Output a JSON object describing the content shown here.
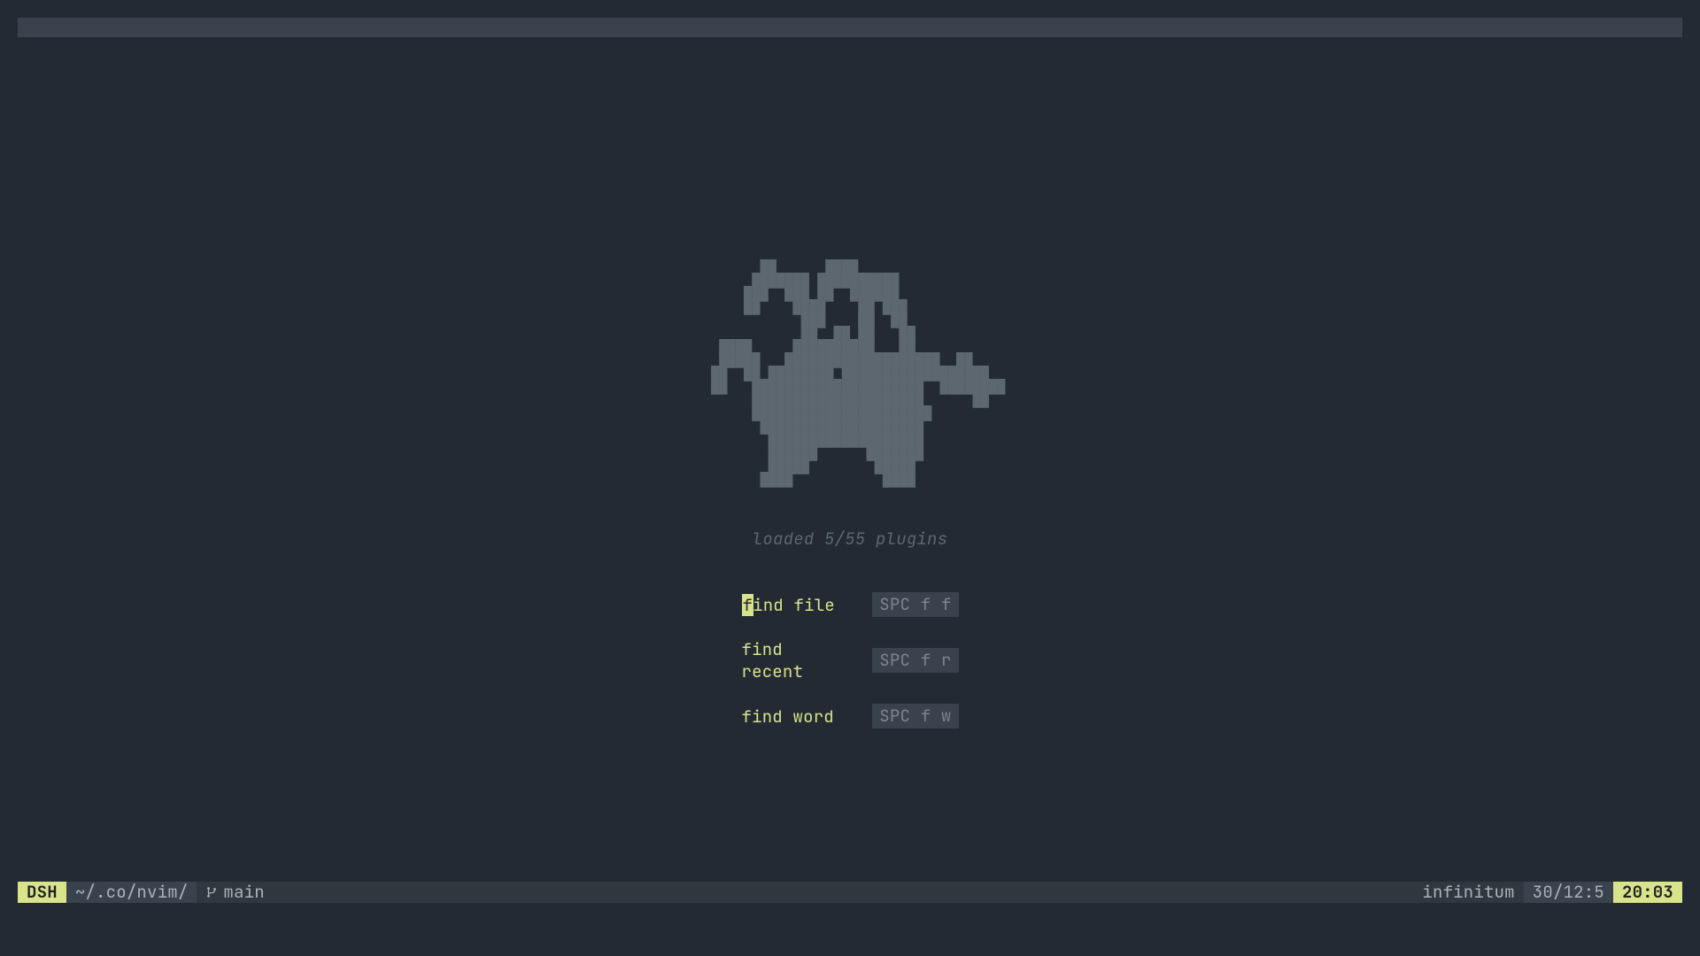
{
  "logo_ascii": "         ██      ████                   \n        ███████ ██████████              \n       ███  ███ ██  ██████              \n       ██    ████    ██ ███             \n              ███    ██  ██             \n              ██  ██ ██   ██            \n    ████     ██████████   ██            \n    █████   ███████████████████  ██     \n   ██  ██ ████████ ██████████████████   \n   ██   █████████████████████  ████████ \n        █████████████████████      ██   \n        ██████████████████████          \n         ████████████████████           \n          ███████████████████           \n          ██████      ███████           \n          █████        █████            \n         ████           ████            ",
  "subtitle": "loaded 5/55 plugins",
  "menu": [
    {
      "label_rest": "ind file",
      "first_char": "f",
      "cursor": true,
      "key": "SPC f f"
    },
    {
      "label_rest": "find recent",
      "first_char": "",
      "cursor": false,
      "key": "SPC f r"
    },
    {
      "label_rest": "find word",
      "first_char": "",
      "cursor": false,
      "key": "SPC f w"
    }
  ],
  "statusline": {
    "mode": "DSH",
    "path": "~/.co/nvim/",
    "branch": "main",
    "filename": "infinitum",
    "position": "30/12:5",
    "time": "20:03"
  }
}
